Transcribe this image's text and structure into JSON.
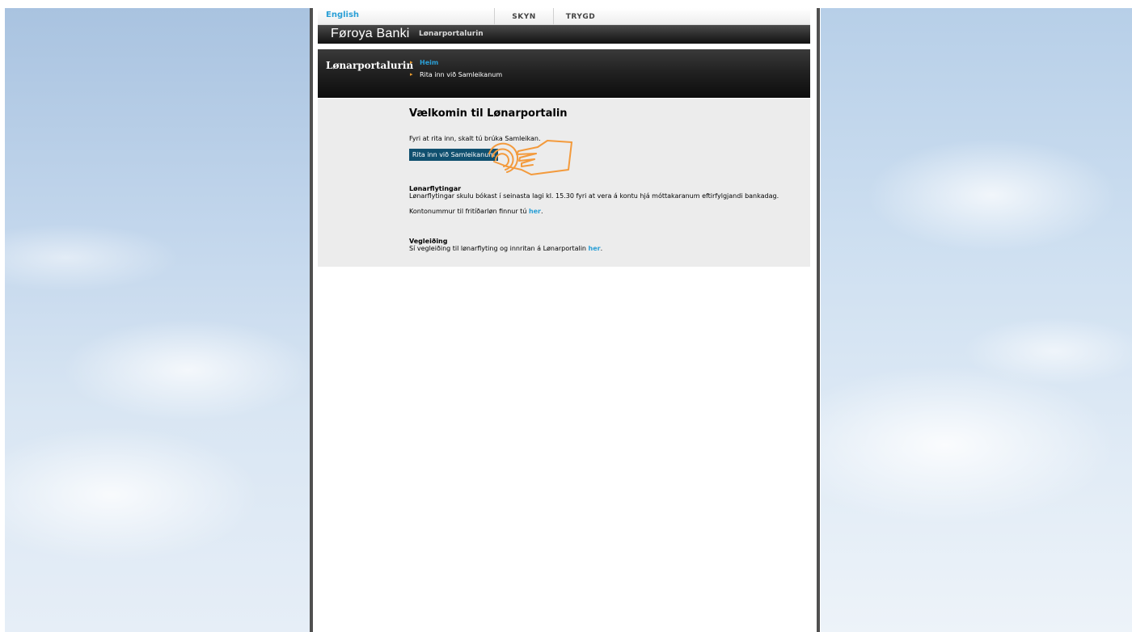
{
  "top_bar": {
    "language_link": "English",
    "tabs": [
      "SKYN",
      "TRYGD"
    ]
  },
  "brand_bar": {
    "logo_text": "Føroya Banki",
    "portal_name": "Lønarportalurin"
  },
  "nav": {
    "title": "Lønarportalurin",
    "items": [
      {
        "label": "Heim",
        "active": true
      },
      {
        "label": "Rita inn við Samleikanum",
        "active": false
      }
    ]
  },
  "main": {
    "heading": "Vælkomin til Lønarportalin",
    "intro": "Fyri at rita inn, skalt tú brúka Samleikan.",
    "login_button": "Rita inn við Samleikanum",
    "transfers": {
      "title": "Lønarflytingar",
      "text": "Lønarflytingar skulu bókast í seinasta lagi kl. 15.30 fyri at vera á kontu hjá móttakaranum eftirfylgjandi bankadag.",
      "account_text": "Kontonummur til fritíðarløn finnur tú",
      "account_link": "her"
    },
    "guide": {
      "title": "Vegleiðing",
      "text": "Sí vegleiðing til lønarflyting og innritan á Lønarportalin",
      "link": "her"
    }
  },
  "colors": {
    "accent_blue": "#2a9fd6",
    "button_bg": "#10506f",
    "arrow_orange": "#f0a030",
    "hand_orange": "#f39a3c"
  },
  "icons": {
    "pointer": "hand-pointer-icon",
    "bullet": "arrow-right-icon"
  }
}
